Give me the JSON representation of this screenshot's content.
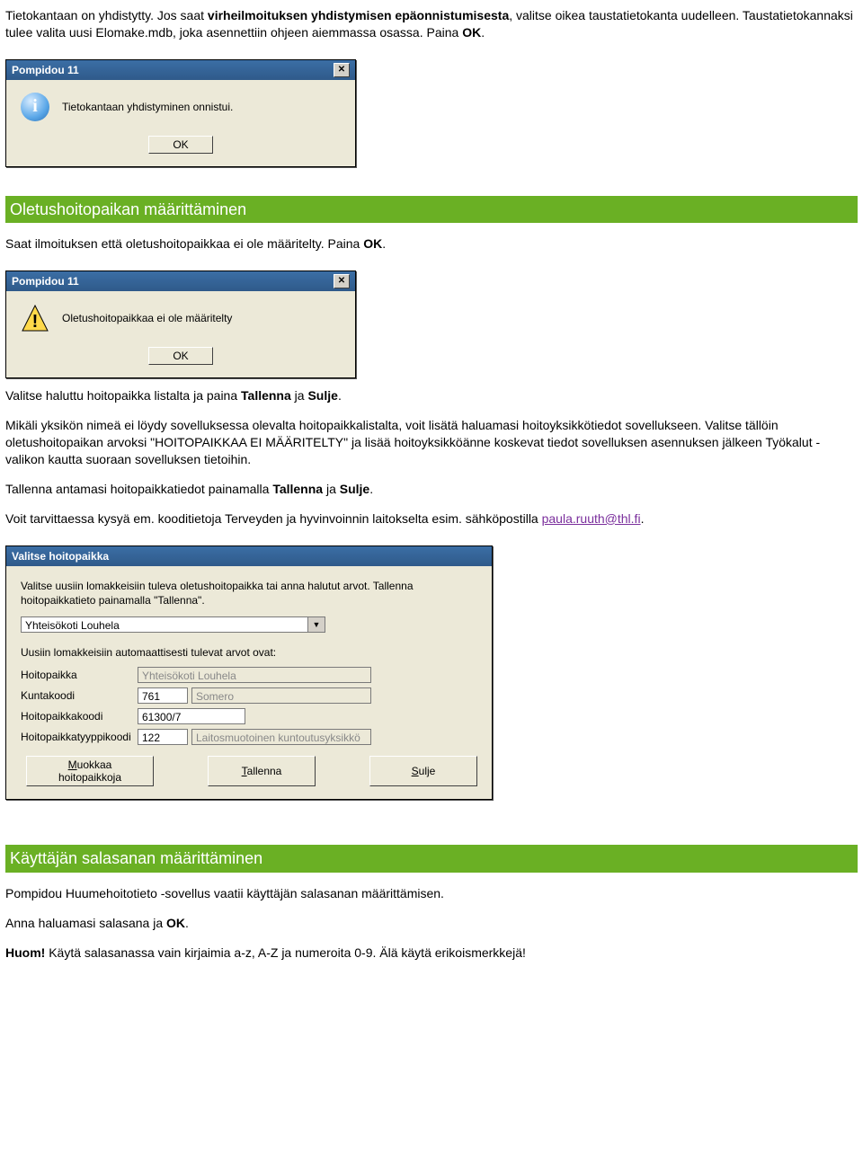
{
  "intro": {
    "p1_a": "Tietokantaan on yhdistytty. Jos saat ",
    "p1_b": "virheilmoituksen yhdistymisen epäonnistumisesta",
    "p1_c": ", valitse oikea taustatietokanta uudelleen. Taustatietokannaksi tulee valita uusi Elomake.mdb, joka asennettiin ohjeen aiemmassa osassa. Paina ",
    "p1_ok": "OK",
    "p1_end": "."
  },
  "dialog1": {
    "title": "Pompidou 11",
    "msg": "Tietokantaan yhdistyminen onnistui.",
    "ok": "OK"
  },
  "heading1": "Oletushoitopaikan määrittäminen",
  "sec1": {
    "p1_a": "Saat ilmoituksen että oletushoitopaikkaa ei ole määritelty. Paina ",
    "p1_ok": "OK",
    "p1_end": "."
  },
  "dialog2": {
    "title": "Pompidou 11",
    "msg": "Oletushoitopaikkaa ei ole määritelty",
    "ok": "OK"
  },
  "sec2": {
    "p1_a": "Valitse haluttu hoitopaikka listalta ja paina ",
    "p1_b": "Tallenna",
    "p1_c": " ja ",
    "p1_d": "Sulje",
    "p1_e": ".",
    "p2": "Mikäli yksikön nimeä ei löydy sovelluksessa olevalta hoitopaikkalistalta, voit lisätä haluamasi hoitoyksikkötiedot sovellukseen. Valitse tällöin oletushoitopaikan arvoksi \"HOITOPAIKKAA EI MÄÄRITELTY\" ja lisää hoitoyksikköänne koskevat tiedot sovelluksen asennuksen jälkeen Työkalut -valikon kautta suoraan sovelluksen tietoihin.",
    "p3_a": "Tallenna antamasi hoitopaikkatiedot painamalla ",
    "p3_b": "Tallenna",
    "p3_c": " ja ",
    "p3_d": "Sulje",
    "p3_e": ".",
    "p4_a": "Voit tarvittaessa kysyä em. kooditietoja Terveyden ja hyvinvoinnin laitokselta esim. sähköpostilla ",
    "p4_link": "paula.ruuth@thl.fi",
    "p4_end": "."
  },
  "dialog3": {
    "title": "Valitse hoitopaikka",
    "help": "Valitse uusiin lomakkeisiin tuleva oletushoitopaikka tai anna halutut arvot. Tallenna hoitopaikkatieto painamalla \"Tallenna\".",
    "combo_value": "Yhteisökoti Louhela",
    "autotext": "Uusiin lomakkeisiin automaattisesti tulevat arvot ovat:",
    "labels": {
      "hoitopaikka": "Hoitopaikka",
      "kuntakoodi": "Kuntakoodi",
      "hoitopaikkakoodi": "Hoitopaikkakoodi",
      "hoitopaikkatyyppikoodi": "Hoitopaikkatyyppikoodi"
    },
    "values": {
      "hoitopaikka": "Yhteisökoti Louhela",
      "kuntakoodi": "761",
      "kuntakoodi_name": "Somero",
      "hoitopaikkakoodi": "61300/7",
      "hoitopaikkatyyppikoodi": "122",
      "hoitopaikkatyyppikoodi_name": "Laitosmuotoinen kuntoutusyksikkö"
    },
    "buttons": {
      "muokkaa_pre": "M",
      "muokkaa_rest": "uokkaa hoitopaikkoja",
      "tallenna_pre": "T",
      "tallenna_rest": "allenna",
      "sulje_pre": "S",
      "sulje_rest": "ulje"
    }
  },
  "heading2": "Käyttäjän salasanan määrittäminen",
  "sec3": {
    "p1": "Pompidou Huumehoitotieto -sovellus vaatii käyttäjän salasanan määrittämisen.",
    "p2_a": "Anna haluamasi salasana ja ",
    "p2_b": "OK",
    "p2_c": ".",
    "p3_a": "Huom!",
    "p3_b": " Käytä salasanassa vain kirjaimia a-z, A-Z ja numeroita 0-9. Älä käytä erikoismerkkejä!"
  }
}
